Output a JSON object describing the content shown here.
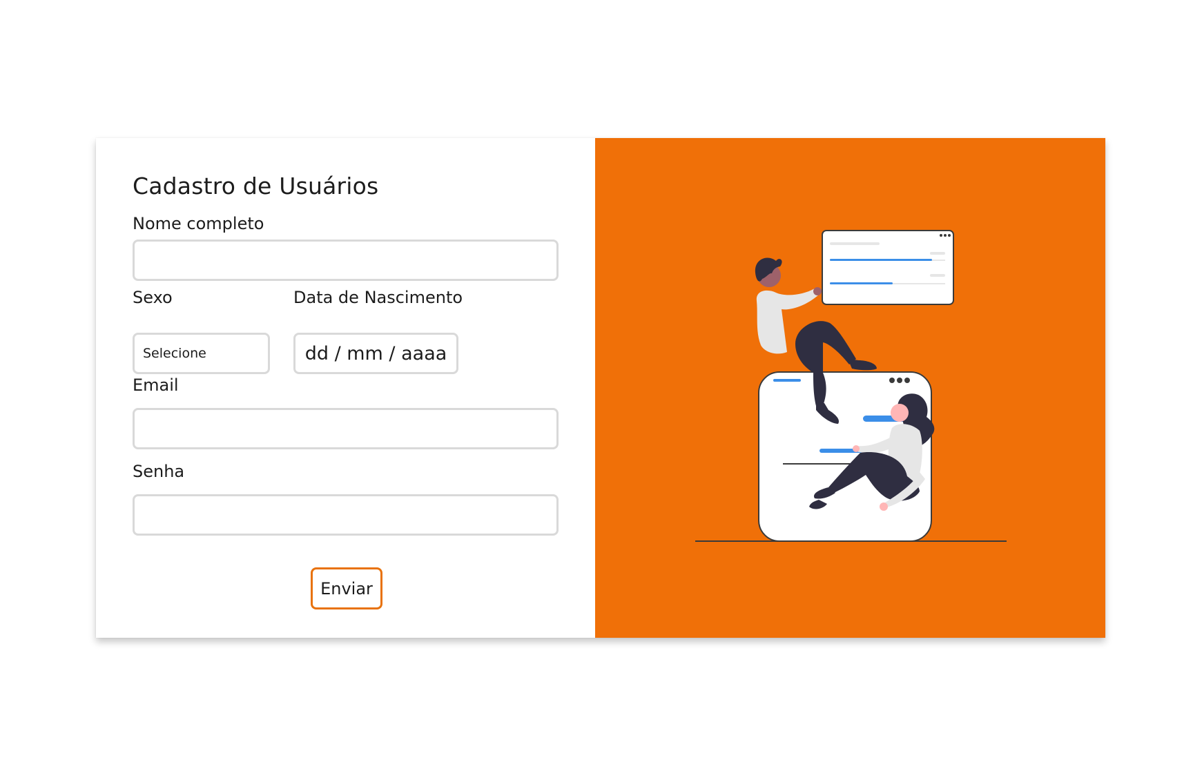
{
  "form": {
    "title": "Cadastro de Usuários",
    "full_name": {
      "label": "Nome completo",
      "value": ""
    },
    "sex": {
      "label": "Sexo",
      "selected": "Selecione"
    },
    "birth_date": {
      "label": "Data de Nascimento",
      "placeholder": "dd / mm / aaaa"
    },
    "email": {
      "label": "Email",
      "value": ""
    },
    "password": {
      "label": "Senha",
      "value": ""
    },
    "submit_label": "Enviar"
  },
  "colors": {
    "accent": "#f07008",
    "button_border": "#e8720c",
    "input_border": "#d9d9d9",
    "illustration_blue": "#3b8ee8",
    "illustration_dark": "#2f2e41"
  },
  "illustration": {
    "icons": [
      "people-collaborating-illustration",
      "browser-window-icon",
      "card-window-icon"
    ]
  }
}
